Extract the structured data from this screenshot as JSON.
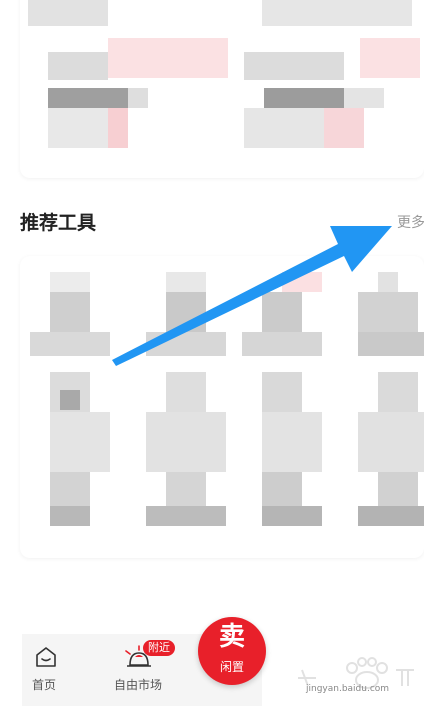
{
  "section": {
    "title": "推荐工具",
    "more": "更多"
  },
  "tabbar": {
    "tabs": [
      {
        "label": "首页",
        "icon": "home-icon"
      },
      {
        "label": "自由市场",
        "icon": "market-icon",
        "badge": "附近"
      }
    ],
    "sell": {
      "big": "卖",
      "small": "闲置"
    }
  },
  "watermark": {
    "text": "jingyan.baidu.com"
  },
  "colors": {
    "accent": "#e8202a",
    "arrow": "#2196f3"
  }
}
